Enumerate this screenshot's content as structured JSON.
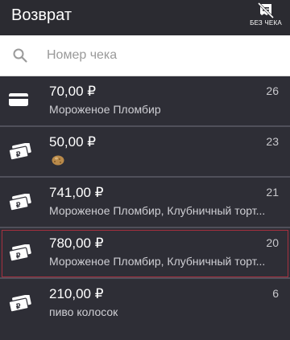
{
  "header": {
    "title": "Возврат",
    "no_receipt_label": "БЕЗ ЧЕКА"
  },
  "search": {
    "placeholder": "Номер чека",
    "value": ""
  },
  "receipts": [
    {
      "amount": "70,00 ₽",
      "items": "Мороженое Пломбир",
      "number": "26",
      "payment": "card"
    },
    {
      "amount": "50,00 ₽",
      "items": "",
      "number": "23",
      "payment": "cash",
      "item_icon": "potato-emoji-icon"
    },
    {
      "amount": "741,00 ₽",
      "items": "Мороженое Пломбир, Клубничный торт...",
      "number": "21",
      "payment": "cash"
    },
    {
      "amount": "780,00 ₽",
      "items": "Мороженое Пломбир, Клубничный торт...",
      "number": "20",
      "payment": "cash",
      "selected": true
    },
    {
      "amount": "210,00 ₽",
      "items": "пиво колосок",
      "number": "6",
      "payment": "cash"
    }
  ],
  "colors": {
    "appbar": "#2b2b31",
    "list_bg": "#2e2e36",
    "divider": "#50505a",
    "selected_outline": "#a6303f"
  }
}
